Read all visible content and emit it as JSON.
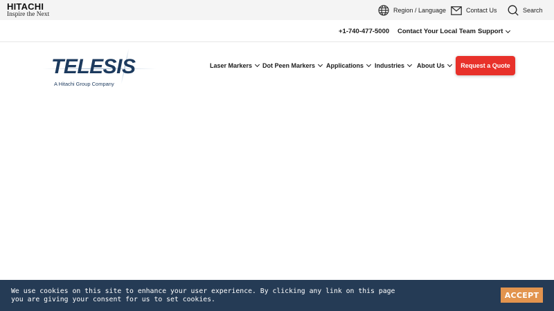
{
  "topbar": {
    "logo_name": "HITACHI",
    "logo_tagline": "Inspire the Next",
    "region_label": "Region / Language",
    "region_icon": "globe-icon",
    "contact_label": "Contact Us",
    "contact_icon": "envelope-icon",
    "search_label": "Search",
    "search_icon": "search-icon"
  },
  "secondary": {
    "phone": "+1-740-477-5000",
    "local_team": "Contact Your Local Team",
    "support": "Support"
  },
  "brand": {
    "name": "TELESIS",
    "subtitle": "A Hitachi Group Company"
  },
  "nav": {
    "items": [
      {
        "label": "Laser Markers"
      },
      {
        "label": "Dot Peen Markers"
      },
      {
        "label": "Applications"
      },
      {
        "label": "Industries"
      },
      {
        "label": "About Us"
      }
    ],
    "cta": "Request a Quote"
  },
  "cookie": {
    "message": "We use cookies on this site to enhance your user experience. By clicking any link on this page you are giving your consent for us to set cookies.",
    "accept": "ACCEPT"
  },
  "colors": {
    "brand_blue": "#1c3a5e",
    "cta_red": "#e8312a",
    "cookie_bg": "#253b55",
    "accept_orange": "#e2944e"
  }
}
